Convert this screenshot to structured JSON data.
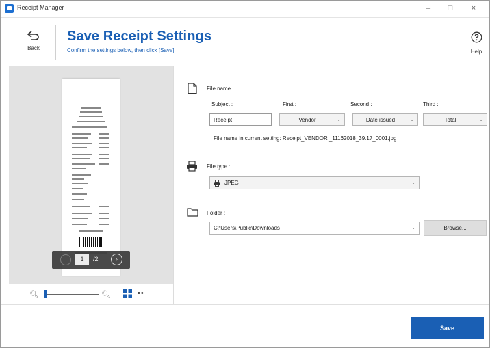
{
  "window": {
    "title": "Receipt Manager",
    "minimize": "–",
    "maximize": "□",
    "close": "×"
  },
  "header": {
    "back_label": "Back",
    "title": "Save Receipt Settings",
    "subtitle": "Confirm the settings below, then click [Save].",
    "help_label": "Help"
  },
  "preview": {
    "current_page": "1",
    "total_pages": "/2"
  },
  "zoom": {
    "level": 0.0
  },
  "file_name": {
    "label": "File name :",
    "subject_label": "Subject :",
    "first_label": "First :",
    "second_label": "Second :",
    "third_label": "Third :",
    "subject_value": "Receipt",
    "first_value": "Vendor",
    "second_value": "Date issued",
    "third_value": "Total",
    "separator": "_",
    "preview_text": "File name in current setting: Receipt_VENDOR _11162018_39.17_0001.jpg"
  },
  "file_type": {
    "label": "File type :",
    "value": "JPEG"
  },
  "folder": {
    "label": "Folder :",
    "path": "C:\\Users\\Public\\Downloads",
    "browse_label": "Browse..."
  },
  "footer": {
    "save_label": "Save"
  },
  "colors": {
    "accent": "#1a5fb4"
  }
}
